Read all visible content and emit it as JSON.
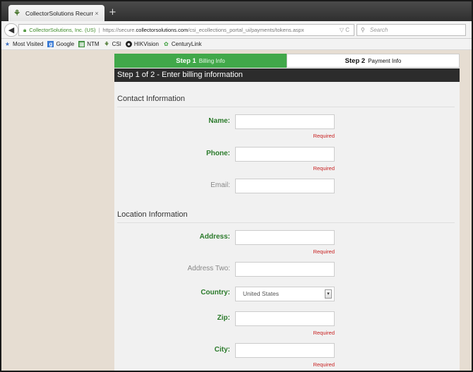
{
  "browser": {
    "tab_title": "CollectorSolutions Recurri...",
    "tab_close": "×",
    "new_tab": "+",
    "site_identity": "CollectorSolutions, Inc. (US)",
    "url_prefix": "https://secure.",
    "url_domain": "collectorsolutions.com",
    "url_path": "/csi_ecollections_portal_ui/payments/tokens.aspx",
    "url_controls": "▽ C",
    "search_placeholder": "Search",
    "bookmarks": [
      {
        "label": "Most Visited",
        "icon": "bookmark-star-icon"
      },
      {
        "label": "Google",
        "icon": "google-icon"
      },
      {
        "label": "NTM",
        "icon": "ntm-icon"
      },
      {
        "label": "CSI",
        "icon": "csi-icon"
      },
      {
        "label": "HIKVision",
        "icon": "hikvision-icon"
      },
      {
        "label": "CenturyLink",
        "icon": "centurylink-icon"
      }
    ]
  },
  "steps": {
    "step1_label": "Step 1",
    "step1_sub": "Billing Info",
    "step2_label": "Step 2",
    "step2_sub": "Payment Info"
  },
  "header": "Step 1 of 2 - Enter billing information",
  "contact": {
    "title": "Contact Information",
    "name_label": "Name:",
    "phone_label": "Phone:",
    "email_label": "Email:"
  },
  "location": {
    "title": "Location Information",
    "address_label": "Address:",
    "address2_label": "Address Two:",
    "country_label": "Country:",
    "country_value": "United States",
    "zip_label": "Zip:",
    "city_label": "City:"
  },
  "required_text": "Required",
  "colors": {
    "step_active": "#41a84a",
    "label_required": "#2a7a2a",
    "required_hint": "#c82020",
    "header_bg": "#2c2c2c"
  }
}
